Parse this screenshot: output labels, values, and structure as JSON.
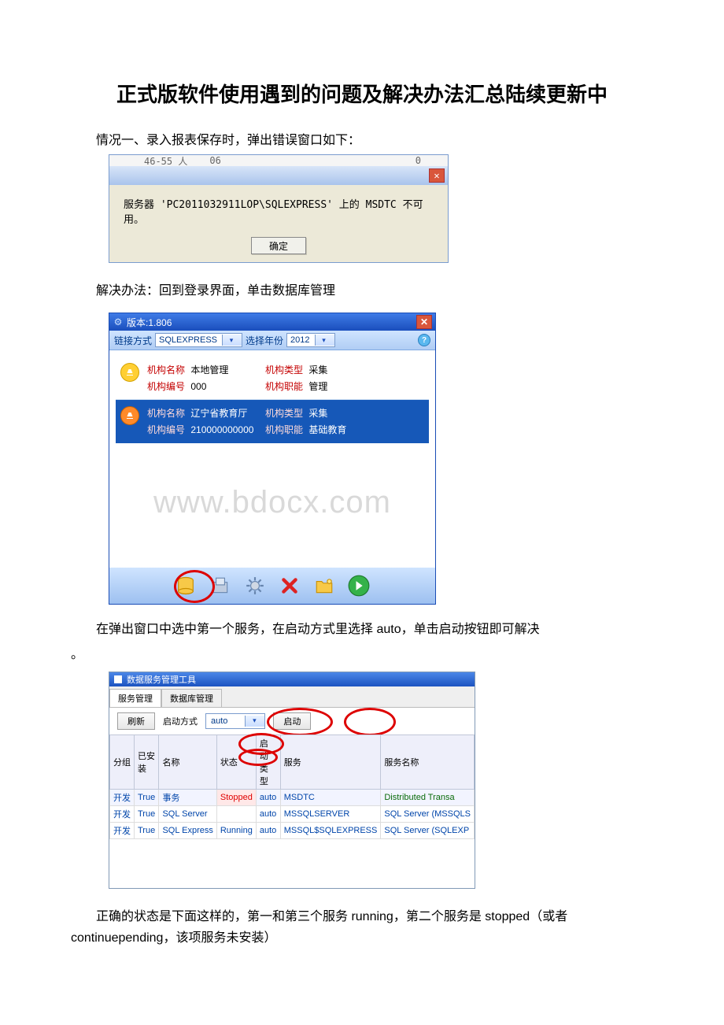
{
  "title": "正式版软件使用遇到的问题及解决办法汇总陆续更新中",
  "intro": "情况一、录入报表保存时，弹出错误窗口如下：",
  "err": {
    "top_a": "46-55 人",
    "top_b": "06",
    "top_c": "0",
    "message": "服务器 'PC2011032911LOP\\SQLEXPRESS' 上的 MSDTC 不可用。",
    "ok": "确定"
  },
  "solution1": "解决办法：回到登录界面，单击数据库管理",
  "login": {
    "title": "版本:1.806",
    "link_label": "链接方式",
    "link_value": "SQLEXPRESS",
    "year_label": "选择年份",
    "year_value": "2012",
    "row0": {
      "name_label": "机构名称",
      "name": "本地管理",
      "code_label": "机构编号",
      "code": "000",
      "type_label": "机构类型",
      "type": "采集",
      "role_label": "机构职能",
      "role": "管理"
    },
    "row1": {
      "name_label": "机构名称",
      "name": "辽宁省教育厅",
      "code_label": "机构编号",
      "code": "210000000000",
      "type_label": "机构类型",
      "type": "采集",
      "role_label": "机构职能",
      "role": "基础教育"
    },
    "watermark": "www.bdocx.com"
  },
  "step2": "在弹出窗口中选中第一个服务，在启动方式里选择 auto，单击启动按钮即可解决",
  "period": "。",
  "svc": {
    "title": "数据服务管理工具",
    "tab1": "服务管理",
    "tab2": "数据库管理",
    "refresh": "刷新",
    "start_mode_label": "启动方式",
    "start_mode_value": "auto",
    "start_btn": "启动",
    "headers": [
      "分组",
      "已安装",
      "名称",
      "状态",
      "启动类型",
      "服务",
      "服务名称"
    ],
    "rows": [
      {
        "g": "开发",
        "i": "True",
        "n": "事务",
        "s": "Stopped",
        "t": "auto",
        "sv": "MSDTC",
        "sn": "Distributed Transa"
      },
      {
        "g": "开发",
        "i": "True",
        "n": "SQL Server",
        "s": "",
        "t": "auto",
        "sv": "MSSQLSERVER",
        "sn": "SQL Server (MSSQLS"
      },
      {
        "g": "开发",
        "i": "True",
        "n": "SQL Express",
        "s": "Running",
        "t": "auto",
        "sv": "MSSQL$SQLEXPRESS",
        "sn": "SQL Server (SQLEXP"
      }
    ]
  },
  "final": "正确的状态是下面这样的，第一和第三个服务 running，第二个服务是 stopped（或者 continuepending，该项服务未安装）"
}
